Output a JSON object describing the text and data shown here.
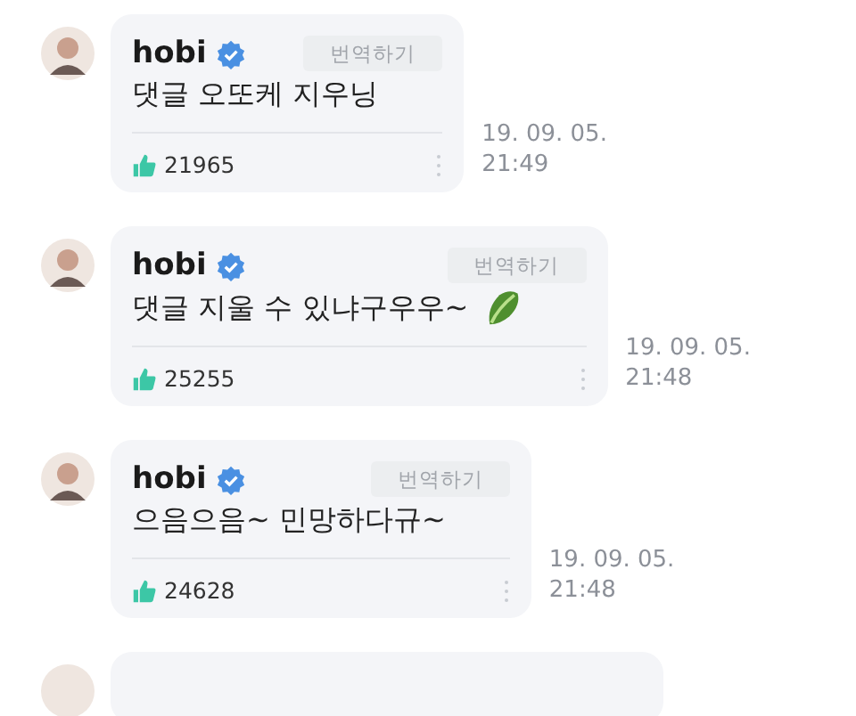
{
  "comments": [
    {
      "kind": "plain",
      "author": "hobi",
      "verified": true,
      "translate_label": "번역하기",
      "text": "댓글 오또케 지우닝",
      "likes": "21965",
      "date": "19. 09. 05.",
      "time": "21:49"
    },
    {
      "kind": "with_emoji",
      "author": "hobi",
      "verified": true,
      "translate_label": "번역하기",
      "text": "댓글 지울 수 있냐구우우~",
      "likes": "25255",
      "date": "19. 09. 05.",
      "time": "21:48"
    },
    {
      "kind": "plain",
      "author": "hobi",
      "verified": true,
      "translate_label": "번역하기",
      "text": "으음으음~ 민망하다규~",
      "likes": "24628",
      "date": "19. 09. 05.",
      "time": "21:48"
    }
  ],
  "more_below": true
}
